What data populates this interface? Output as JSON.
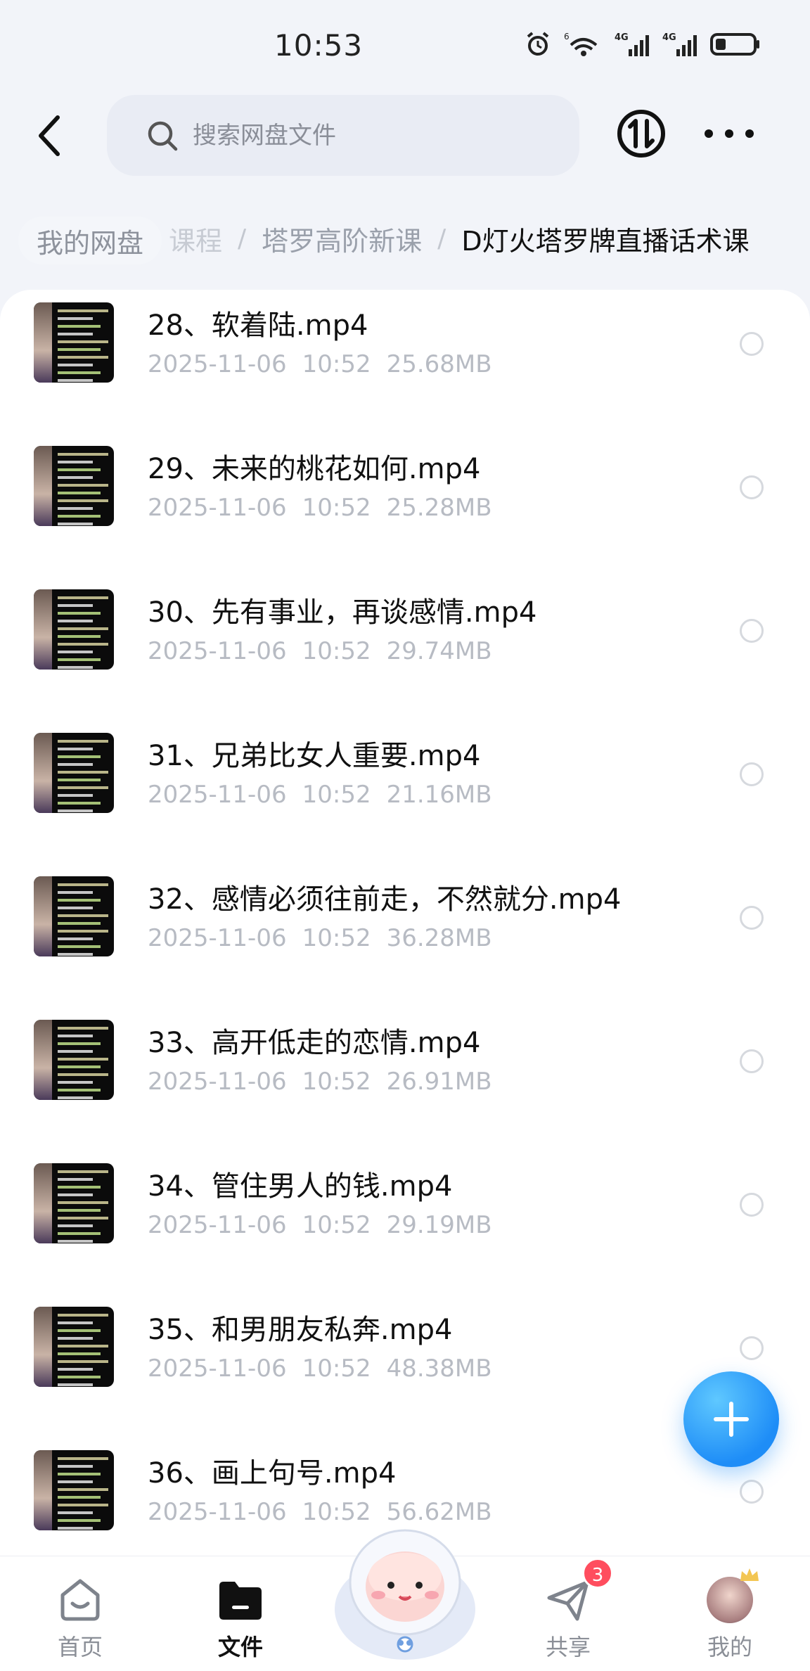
{
  "status_bar": {
    "time": "10:53",
    "signal_1": "4G",
    "signal_2": "4G",
    "wifi": "6"
  },
  "top_bar": {
    "search_placeholder": "搜索网盘文件"
  },
  "breadcrumb": {
    "home": "我的网盘",
    "partial": "课程",
    "level2": "塔罗高阶新课",
    "current": "D灯火塔罗牌直播话术课"
  },
  "files": [
    {
      "name": "28、软着陆.mp4",
      "date": "2025-11-06",
      "time": "10:52",
      "size": "25.68MB"
    },
    {
      "name": "29、未来的桃花如何.mp4",
      "date": "2025-11-06",
      "time": "10:52",
      "size": "25.28MB"
    },
    {
      "name": "30、先有事业，再谈感情.mp4",
      "date": "2025-11-06",
      "time": "10:52",
      "size": "29.74MB"
    },
    {
      "name": "31、兄弟比女人重要.mp4",
      "date": "2025-11-06",
      "time": "10:52",
      "size": "21.16MB"
    },
    {
      "name": "32、感情必须往前走，不然就分.mp4",
      "date": "2025-11-06",
      "time": "10:52",
      "size": "36.28MB"
    },
    {
      "name": "33、高开低走的恋情.mp4",
      "date": "2025-11-06",
      "time": "10:52",
      "size": "26.91MB"
    },
    {
      "name": "34、管住男人的钱.mp4",
      "date": "2025-11-06",
      "time": "10:52",
      "size": "29.19MB"
    },
    {
      "name": "35、和男朋友私奔.mp4",
      "date": "2025-11-06",
      "time": "10:52",
      "size": "48.38MB"
    },
    {
      "name": "36、画上句号.mp4",
      "date": "2025-11-06",
      "time": "10:52",
      "size": "56.62MB"
    }
  ],
  "bottom_nav": {
    "home": "首页",
    "files": "文件",
    "share": "共享",
    "share_badge": "3",
    "mine": "我的"
  },
  "colors": {
    "accent": "#1e8df7",
    "badge": "#ff4d5e"
  }
}
